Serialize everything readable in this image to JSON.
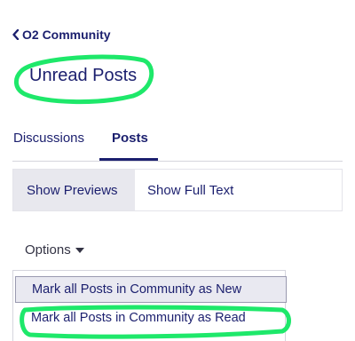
{
  "nav": {
    "back_label": "O2 Community",
    "back_icon": "chevron-left-icon"
  },
  "page": {
    "title": "Unread Posts"
  },
  "tabs": [
    {
      "label": "Discussions",
      "active": false
    },
    {
      "label": "Posts",
      "active": true
    }
  ],
  "view_toggle": {
    "previews_label": "Show Previews",
    "fulltext_label": "Show Full Text",
    "selected": "Show Previews"
  },
  "options": {
    "label": "Options",
    "icon": "caret-down-icon",
    "menu": [
      {
        "label": "Mark all Posts in Community as New"
      },
      {
        "label": "Mark all Posts in Community as Read"
      }
    ]
  },
  "colors": {
    "brand_navy": "#1b1f6e",
    "highlight_green": "#1ee86a",
    "selected_bg": "#e8e8ee"
  }
}
